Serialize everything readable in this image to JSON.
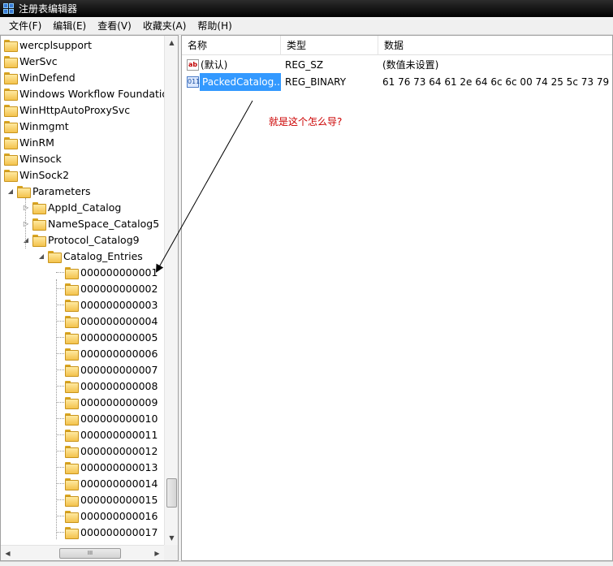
{
  "window": {
    "title": "注册表编辑器"
  },
  "menu": [
    "文件(F)",
    "编辑(E)",
    "查看(V)",
    "收藏夹(A)",
    "帮助(H)"
  ],
  "tree": {
    "items": [
      {
        "label": "wercplsupport",
        "level": 0,
        "expander": ""
      },
      {
        "label": "WerSvc",
        "level": 0,
        "expander": ""
      },
      {
        "label": "WinDefend",
        "level": 0,
        "expander": ""
      },
      {
        "label": "Windows Workflow Foundation",
        "level": 0,
        "expander": ""
      },
      {
        "label": "WinHttpAutoProxySvc",
        "level": 0,
        "expander": ""
      },
      {
        "label": "Winmgmt",
        "level": 0,
        "expander": ""
      },
      {
        "label": "WinRM",
        "level": 0,
        "expander": ""
      },
      {
        "label": "Winsock",
        "level": 0,
        "expander": ""
      },
      {
        "label": "WinSock2",
        "level": 0,
        "expander": ""
      },
      {
        "label": "Parameters",
        "level": 1,
        "expander": "expanded"
      },
      {
        "label": "AppId_Catalog",
        "level": 2,
        "expander": "collapsed"
      },
      {
        "label": "NameSpace_Catalog5",
        "level": 2,
        "expander": "collapsed"
      },
      {
        "label": "Protocol_Catalog9",
        "level": 2,
        "expander": "expanded"
      },
      {
        "label": "Catalog_Entries",
        "level": 3,
        "expander": "expanded"
      },
      {
        "label": "000000000001",
        "level": 4,
        "expander": ""
      },
      {
        "label": "000000000002",
        "level": 4,
        "expander": ""
      },
      {
        "label": "000000000003",
        "level": 4,
        "expander": ""
      },
      {
        "label": "000000000004",
        "level": 4,
        "expander": ""
      },
      {
        "label": "000000000005",
        "level": 4,
        "expander": ""
      },
      {
        "label": "000000000006",
        "level": 4,
        "expander": ""
      },
      {
        "label": "000000000007",
        "level": 4,
        "expander": ""
      },
      {
        "label": "000000000008",
        "level": 4,
        "expander": ""
      },
      {
        "label": "000000000009",
        "level": 4,
        "expander": ""
      },
      {
        "label": "000000000010",
        "level": 4,
        "expander": ""
      },
      {
        "label": "000000000011",
        "level": 4,
        "expander": ""
      },
      {
        "label": "000000000012",
        "level": 4,
        "expander": ""
      },
      {
        "label": "000000000013",
        "level": 4,
        "expander": ""
      },
      {
        "label": "000000000014",
        "level": 4,
        "expander": ""
      },
      {
        "label": "000000000015",
        "level": 4,
        "expander": ""
      },
      {
        "label": "000000000016",
        "level": 4,
        "expander": ""
      },
      {
        "label": "000000000017",
        "level": 4,
        "expander": ""
      }
    ],
    "hscroll_grip": "III"
  },
  "list": {
    "columns": [
      "名称",
      "类型",
      "数据"
    ],
    "rows": [
      {
        "icon": "ab",
        "icon_kind": "string-value-icon",
        "name": "(默认)",
        "type": "REG_SZ",
        "data": "(数值未设置)",
        "selected": false
      },
      {
        "icon": "011",
        "icon_kind": "binary-value-icon",
        "name": "PackedCatalog...",
        "type": "REG_BINARY",
        "data": "61 76 73 64 61 2e 64 6c 6c 00 74 25 5c 73 79 ...",
        "selected": true
      }
    ]
  },
  "annotation": {
    "text": "就是这个怎么导?",
    "color": "#cc0000"
  },
  "colors": {
    "selection": "#3399ff",
    "titlebar": "#000000",
    "folder": "#f3c24c"
  }
}
